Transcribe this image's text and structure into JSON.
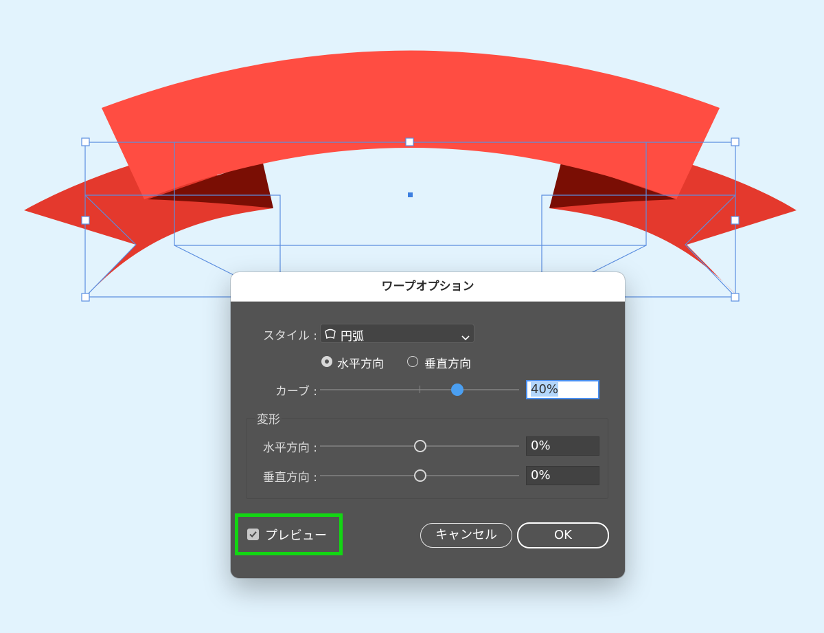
{
  "canvas": {
    "background": "#e2f3fd",
    "ribbon_colors": {
      "front": "#ff4d42",
      "back": "#e4392d",
      "fold": "#7a0e04"
    },
    "selection_color": "#5b8ee0"
  },
  "dialog": {
    "title": "ワープオプション",
    "style_label": "スタイル :",
    "style_value": "円弧",
    "style_icon": "arc-warp-icon",
    "orientation": {
      "horizontal_label": "水平方向",
      "vertical_label": "垂直方向",
      "selected": "horizontal"
    },
    "bend": {
      "label": "カーブ :",
      "value": "40%",
      "fraction": 0.7
    },
    "distortion": {
      "group_label": "変形",
      "horizontal": {
        "label": "水平方向 :",
        "value": "0%",
        "fraction": 0.5
      },
      "vertical": {
        "label": "垂直方向 :",
        "value": "0%",
        "fraction": 0.5
      }
    },
    "preview": {
      "label": "プレビュー",
      "checked": true
    },
    "cancel_label": "キャンセル",
    "ok_label": "OK",
    "highlight_color": "#13d613"
  }
}
